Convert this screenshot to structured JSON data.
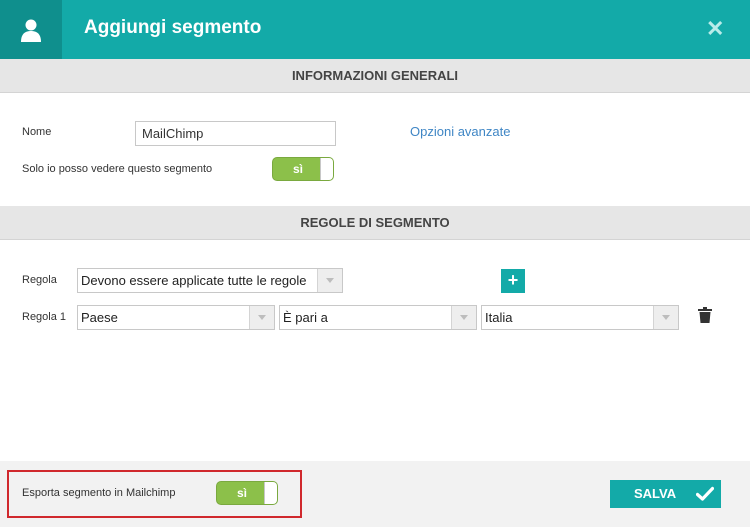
{
  "header": {
    "title": "Aggiungi segmento",
    "close_symbol": "✕"
  },
  "general_section": {
    "title": "INFORMAZIONI GENERALI",
    "name_label": "Nome",
    "name_value": "MailChimp",
    "advanced_link": "Opzioni avanzate",
    "visibility_label": "Solo io posso vedere questo segmento",
    "visibility_toggle": "sì"
  },
  "rules_section": {
    "title": "REGOLE DI SEGMENTO",
    "rule_label": "Regola",
    "rule_mode": "Devono essere applicate tutte le regole",
    "add_symbol": "+",
    "rules": [
      {
        "label": "Regola 1",
        "field": "Paese",
        "operator": "È pari a",
        "value": "Italia"
      }
    ]
  },
  "footer": {
    "export_label": "Esporta segmento in Mailchimp",
    "export_toggle": "sì",
    "save_label": "SALVA"
  },
  "colors": {
    "accent": "#13aaa8",
    "accent_dark": "#0f8f8d",
    "toggle_on": "#8cc04a",
    "highlight": "#d0282d"
  },
  "icons": {
    "header": "user-icon",
    "close": "close-icon",
    "add": "plus-icon",
    "delete": "trash-icon",
    "save": "check-icon"
  }
}
